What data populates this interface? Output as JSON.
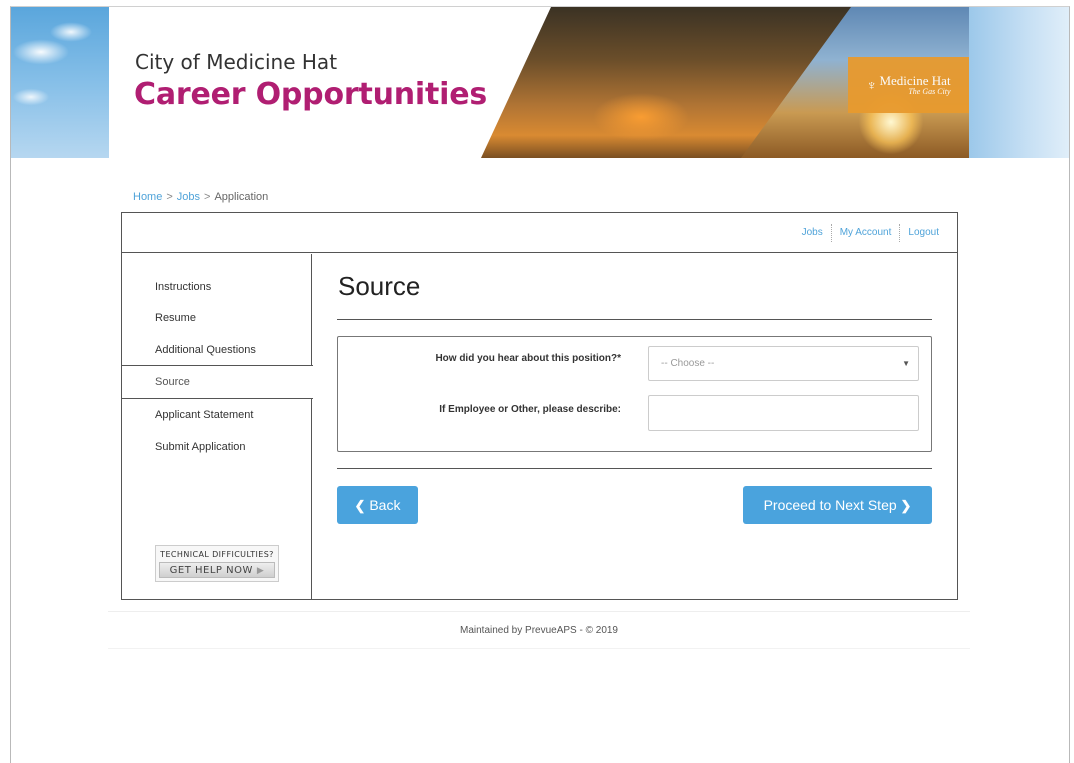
{
  "header": {
    "title": "City of Medicine Hat",
    "subtitle": "Career Opportunities",
    "logo_line1": "Medicine Hat",
    "logo_line2": "The Gas City"
  },
  "breadcrumb": {
    "home": "Home",
    "jobs": "Jobs",
    "current": "Application",
    "separator": ">"
  },
  "topnav": {
    "jobs": "Jobs",
    "my_account": "My Account",
    "logout": "Logout"
  },
  "sidebar": {
    "items": [
      {
        "label": "Instructions",
        "active": false
      },
      {
        "label": "Resume",
        "active": false
      },
      {
        "label": "Additional Questions",
        "active": false
      },
      {
        "label": "Source",
        "active": true
      },
      {
        "label": "Applicant Statement",
        "active": false
      },
      {
        "label": "Submit Application",
        "active": false
      }
    ],
    "help_line1": "TECHNICAL DIFFICULTIES?",
    "help_line2": "GET HELP NOW"
  },
  "main": {
    "heading": "Source",
    "fields": {
      "source_label": "How did you hear about this position?*",
      "source_value": "-- Choose --",
      "describe_label": "If Employee or Other, please describe:",
      "describe_value": ""
    },
    "back_label": "Back",
    "next_label": "Proceed to Next Step"
  },
  "footer": {
    "text": "Maintained by PrevueAPS - © 2019"
  },
  "colors": {
    "brand_magenta": "#b01e72",
    "accent_blue": "#4aa3dd",
    "link_blue": "#4fa3d9",
    "logo_orange": "#e89a2e"
  }
}
